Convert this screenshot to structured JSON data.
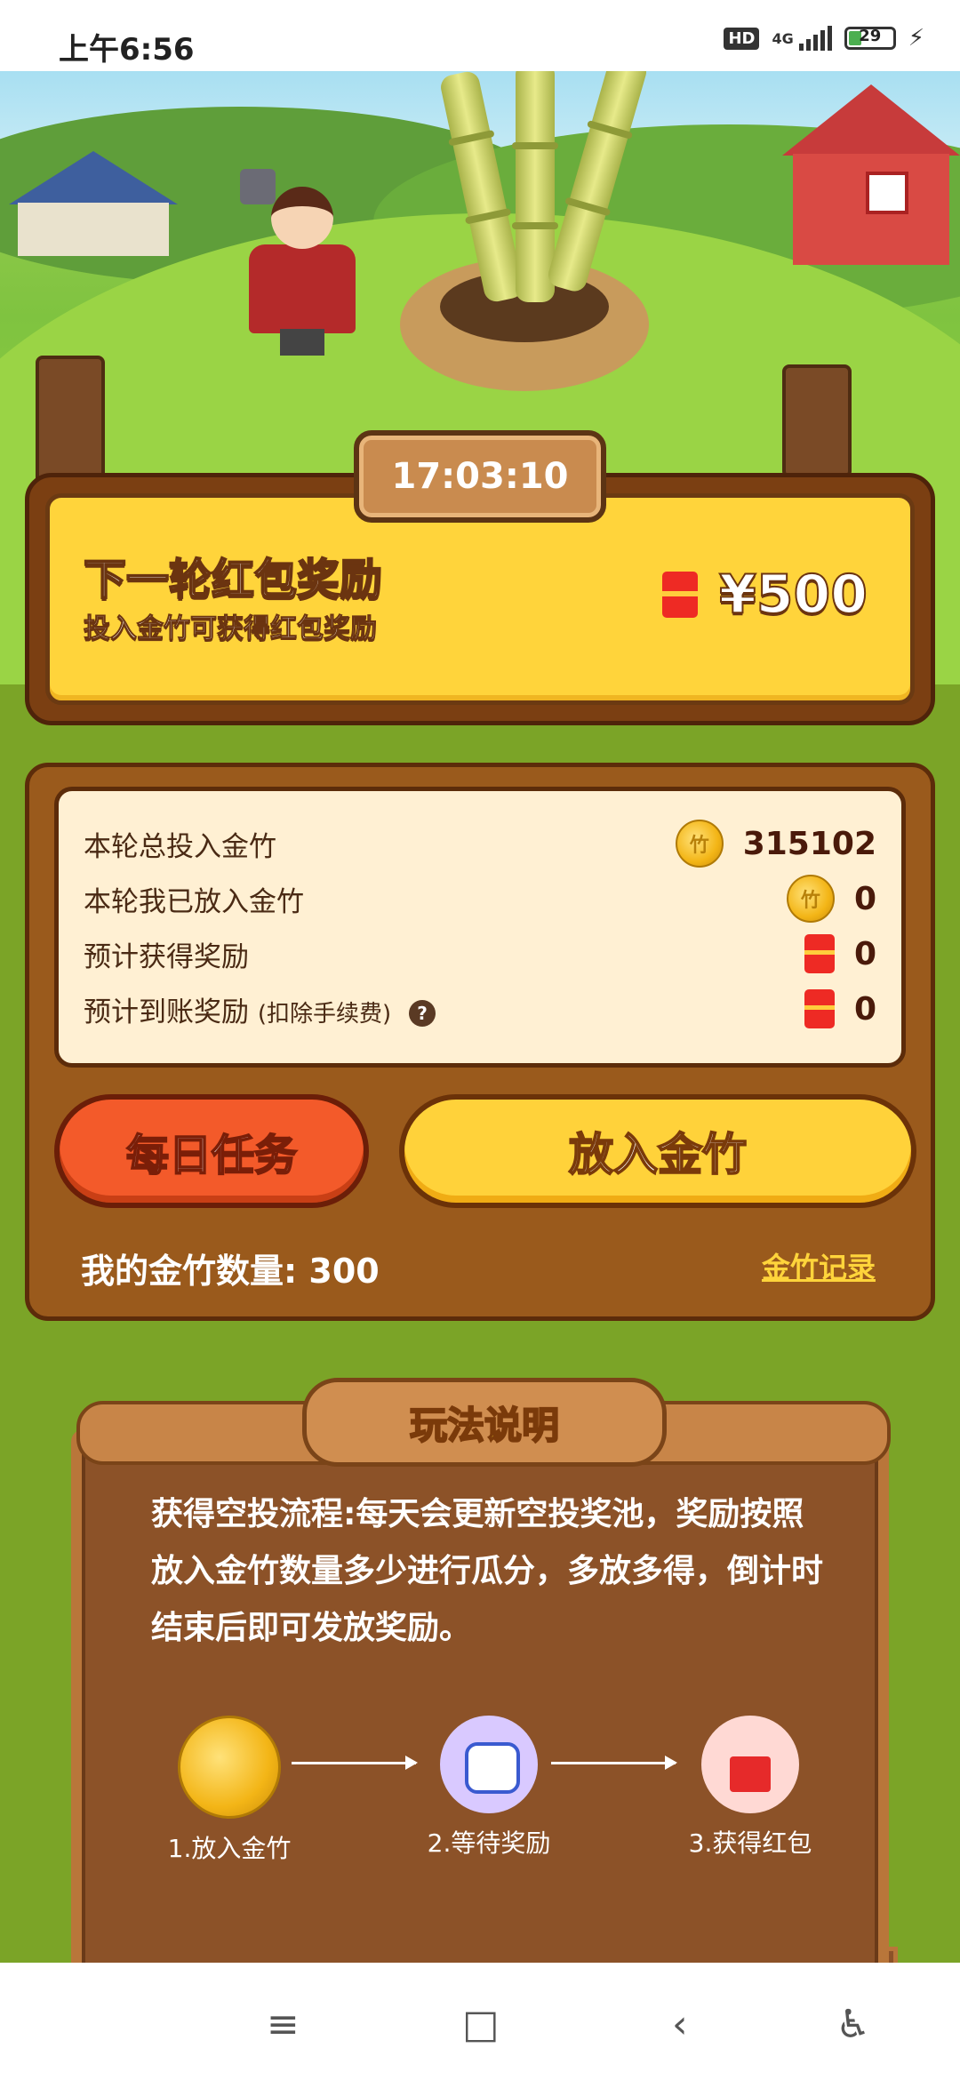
{
  "status_bar": {
    "time": "上午6:56",
    "hd": "HD",
    "network": "4G",
    "battery": "29",
    "battery_level": 0.29
  },
  "countdown": "17:03:10",
  "reward": {
    "title": "下一轮红包奖励",
    "subtitle": "投入金竹可获得红包奖励",
    "amount": "¥500"
  },
  "stats": {
    "rows": [
      {
        "label": "本轮总投入金竹",
        "value": "315102",
        "icon": "coin-icon"
      },
      {
        "label": "本轮我已放入金竹",
        "value": "0",
        "icon": "coin-icon"
      },
      {
        "label": "预计获得奖励",
        "value": "0",
        "icon": "red-packet-icon"
      },
      {
        "label": "预计到账奖励",
        "note": "(扣除手续费)",
        "help": "?",
        "value": "0",
        "icon": "red-packet-icon"
      }
    ]
  },
  "buttons": {
    "daily_task": "每日任务",
    "deposit": "放入金竹"
  },
  "my_count": "我的金竹数量: 300",
  "record_link": "金竹记录",
  "rules": {
    "title": "玩法说明",
    "text": "获得空投流程:每天会更新空投奖池，奖励按照放入金竹数量多少进行瓜分，多放多得，倒计时结束后即可发放奖励。",
    "steps": [
      {
        "label": "1.放入金竹",
        "icon": "gold-bamboo-coin-icon"
      },
      {
        "label": "2.等待奖励",
        "icon": "mascot-waiting-icon"
      },
      {
        "label": "3.获得红包",
        "icon": "red-gift-box-icon"
      }
    ]
  },
  "nav": {
    "menu": "≡",
    "home": "□",
    "back": "‹",
    "accessibility": "♿"
  }
}
